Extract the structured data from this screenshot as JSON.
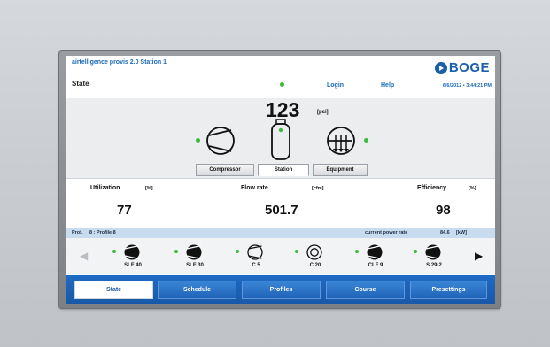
{
  "header": {
    "app_title": "airtelligence provis 2.0  Station 1",
    "logo_text": "BOGE",
    "state_label": "State",
    "login_label": "Login",
    "help_label": "Help",
    "date": "6/6/2012",
    "time": "• 3:44:21 PM"
  },
  "station": {
    "pressure_value": "123",
    "pressure_unit": "[psi]",
    "status_color": "#3dbb3d",
    "tabs": [
      "Compressor",
      "Station",
      "Equipment"
    ],
    "active_tab": "Station"
  },
  "stats": {
    "utilization": {
      "label": "Utilization",
      "unit": "[%]",
      "value": "77"
    },
    "flow_rate": {
      "label": "Flow rate",
      "unit": "[cfm]",
      "value": "501.7"
    },
    "efficiency": {
      "label": "Efficiency",
      "unit": "[%]",
      "value": "98"
    }
  },
  "infobar": {
    "profile_label": "Prof.",
    "profile_value": "8 : Profile 8",
    "power_label": "current power rate",
    "power_value": "84.6",
    "power_unit": "[kW]"
  },
  "machines": [
    {
      "name": "SLF 40",
      "icon": "compressor-filled-icon"
    },
    {
      "name": "SLF 30",
      "icon": "compressor-filled-icon"
    },
    {
      "name": "C 5",
      "icon": "compressor-outline-icon"
    },
    {
      "name": "C 20",
      "icon": "compressor-target-icon"
    },
    {
      "name": "CLF 9",
      "icon": "compressor-filled-icon"
    },
    {
      "name": "S 29-2",
      "icon": "compressor-filled-icon"
    }
  ],
  "nav": {
    "items": [
      "State",
      "Schedule",
      "Profiles",
      "Course",
      "Presettings"
    ],
    "active": "State"
  },
  "colors": {
    "accent": "#1b5fa8",
    "nav_bar": "#1f6bc4",
    "status_green": "#3dbb3d"
  }
}
